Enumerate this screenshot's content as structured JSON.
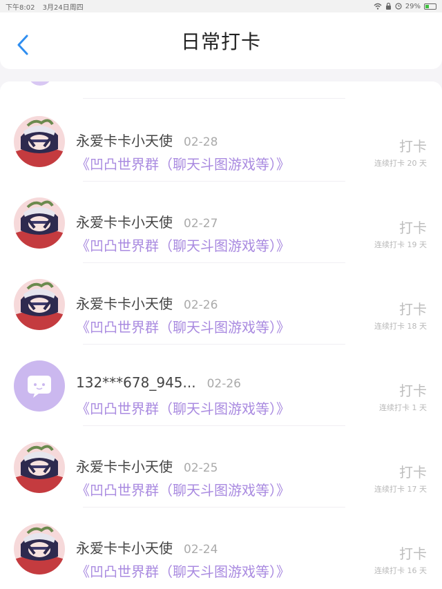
{
  "status_bar": {
    "time": "下午8:02",
    "date": "3月24日周四",
    "battery": "29%",
    "wifi_icon": "wifi-icon",
    "lock_icon": "lock-icon",
    "alarm_icon": "alarm-icon"
  },
  "header": {
    "title": "日常打卡",
    "back_icon": "chevron-left-icon"
  },
  "colors": {
    "accent": "#a98ae0",
    "back": "#2f8ef0"
  },
  "entries": [
    {
      "user": "永爱卡卡小天使",
      "date": "02-28",
      "group": "《凹凸世界群（聊天斗图游戏等）》",
      "action": "打卡",
      "streak": "连续打卡 20 天",
      "avatar": "anime-avatar"
    },
    {
      "user": "永爱卡卡小天使",
      "date": "02-27",
      "group": "《凹凸世界群（聊天斗图游戏等）》",
      "action": "打卡",
      "streak": "连续打卡 19 天",
      "avatar": "anime-avatar"
    },
    {
      "user": "永爱卡卡小天使",
      "date": "02-26",
      "group": "《凹凸世界群（聊天斗图游戏等）》",
      "action": "打卡",
      "streak": "连续打卡 18 天",
      "avatar": "anime-avatar"
    },
    {
      "user": "132***678_945...",
      "date": "02-26",
      "group": "《凹凸世界群（聊天斗图游戏等）》",
      "action": "打卡",
      "streak": "连续打卡 1 天",
      "avatar": "default-chat-avatar"
    },
    {
      "user": "永爱卡卡小天使",
      "date": "02-25",
      "group": "《凹凸世界群（聊天斗图游戏等）》",
      "action": "打卡",
      "streak": "连续打卡 17 天",
      "avatar": "anime-avatar"
    },
    {
      "user": "永爱卡卡小天使",
      "date": "02-24",
      "group": "《凹凸世界群（聊天斗图游戏等）》",
      "action": "打卡",
      "streak": "连续打卡 16 天",
      "avatar": "anime-avatar"
    }
  ]
}
